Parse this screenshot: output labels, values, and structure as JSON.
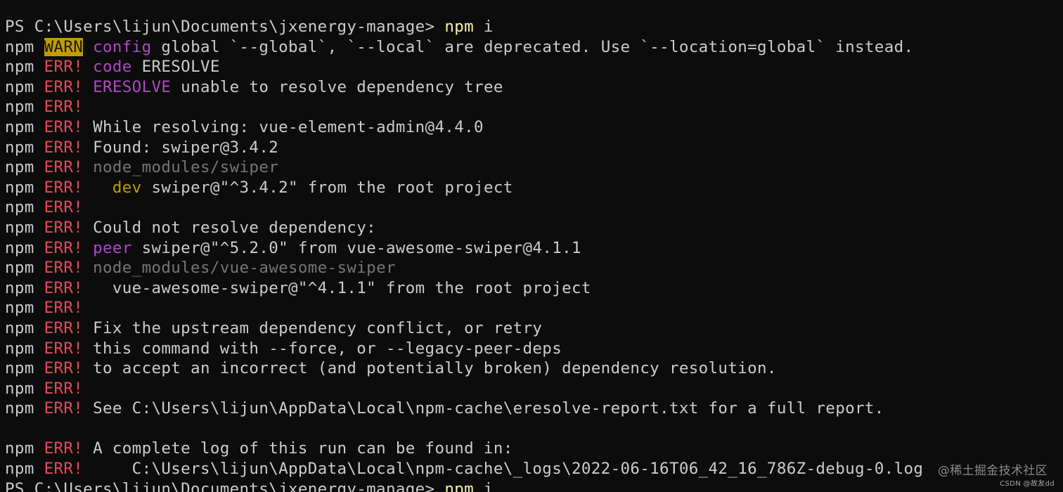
{
  "terminal": {
    "lines": [
      [
        {
          "text": "PS C:\\Users\\lijun\\Documents\\jxenergy-manage> ",
          "style": "default"
        },
        {
          "text": "npm",
          "style": "cmd"
        },
        {
          "text": " i",
          "style": "default"
        }
      ],
      [
        {
          "text": "npm ",
          "style": "default"
        },
        {
          "text": "WARN",
          "style": "warn"
        },
        {
          "text": " ",
          "style": "default"
        },
        {
          "text": "config",
          "style": "magenta"
        },
        {
          "text": " global `--global`, `--local` are deprecated. Use `--location=global` instead.",
          "style": "default"
        }
      ],
      [
        {
          "text": "npm ",
          "style": "default"
        },
        {
          "text": "ERR!",
          "style": "err"
        },
        {
          "text": " ",
          "style": "default"
        },
        {
          "text": "code",
          "style": "magenta"
        },
        {
          "text": " ERESOLVE",
          "style": "default"
        }
      ],
      [
        {
          "text": "npm ",
          "style": "default"
        },
        {
          "text": "ERR!",
          "style": "err"
        },
        {
          "text": " ",
          "style": "default"
        },
        {
          "text": "ERESOLVE",
          "style": "magenta"
        },
        {
          "text": " unable to resolve dependency tree",
          "style": "default"
        }
      ],
      [
        {
          "text": "npm ",
          "style": "default"
        },
        {
          "text": "ERR!",
          "style": "err"
        }
      ],
      [
        {
          "text": "npm ",
          "style": "default"
        },
        {
          "text": "ERR!",
          "style": "err"
        },
        {
          "text": " While resolving: vue-element-admin@4.4.0",
          "style": "default"
        }
      ],
      [
        {
          "text": "npm ",
          "style": "default"
        },
        {
          "text": "ERR!",
          "style": "err"
        },
        {
          "text": " Found: swiper@3.4.2",
          "style": "default"
        }
      ],
      [
        {
          "text": "npm ",
          "style": "default"
        },
        {
          "text": "ERR!",
          "style": "err"
        },
        {
          "text": " ",
          "style": "default"
        },
        {
          "text": "node_modules/swiper",
          "style": "gray"
        }
      ],
      [
        {
          "text": "npm ",
          "style": "default"
        },
        {
          "text": "ERR!",
          "style": "err"
        },
        {
          "text": "   ",
          "style": "default"
        },
        {
          "text": "dev",
          "style": "yellow"
        },
        {
          "text": " swiper@\"^3.4.2\" from the root project",
          "style": "default"
        }
      ],
      [
        {
          "text": "npm ",
          "style": "default"
        },
        {
          "text": "ERR!",
          "style": "err"
        }
      ],
      [
        {
          "text": "npm ",
          "style": "default"
        },
        {
          "text": "ERR!",
          "style": "err"
        },
        {
          "text": " Could not resolve dependency:",
          "style": "default"
        }
      ],
      [
        {
          "text": "npm ",
          "style": "default"
        },
        {
          "text": "ERR!",
          "style": "err"
        },
        {
          "text": " ",
          "style": "default"
        },
        {
          "text": "peer",
          "style": "magenta"
        },
        {
          "text": " swiper@\"^5.2.0\" from vue-awesome-swiper@4.1.1",
          "style": "default"
        }
      ],
      [
        {
          "text": "npm ",
          "style": "default"
        },
        {
          "text": "ERR!",
          "style": "err"
        },
        {
          "text": " ",
          "style": "default"
        },
        {
          "text": "node_modules/vue-awesome-swiper",
          "style": "gray"
        }
      ],
      [
        {
          "text": "npm ",
          "style": "default"
        },
        {
          "text": "ERR!",
          "style": "err"
        },
        {
          "text": "   vue-awesome-swiper@\"^4.1.1\" from the root project",
          "style": "default"
        }
      ],
      [
        {
          "text": "npm ",
          "style": "default"
        },
        {
          "text": "ERR!",
          "style": "err"
        }
      ],
      [
        {
          "text": "npm ",
          "style": "default"
        },
        {
          "text": "ERR!",
          "style": "err"
        },
        {
          "text": " Fix the upstream dependency conflict, or retry",
          "style": "default"
        }
      ],
      [
        {
          "text": "npm ",
          "style": "default"
        },
        {
          "text": "ERR!",
          "style": "err"
        },
        {
          "text": " this command with --force, or --legacy-peer-deps",
          "style": "default"
        }
      ],
      [
        {
          "text": "npm ",
          "style": "default"
        },
        {
          "text": "ERR!",
          "style": "err"
        },
        {
          "text": " to accept an incorrect (and potentially broken) dependency resolution.",
          "style": "default"
        }
      ],
      [
        {
          "text": "npm ",
          "style": "default"
        },
        {
          "text": "ERR!",
          "style": "err"
        }
      ],
      [
        {
          "text": "npm ",
          "style": "default"
        },
        {
          "text": "ERR!",
          "style": "err"
        },
        {
          "text": " See C:\\Users\\lijun\\AppData\\Local\\npm-cache\\eresolve-report.txt for a full report.",
          "style": "default"
        }
      ],
      [],
      [
        {
          "text": "npm ",
          "style": "default"
        },
        {
          "text": "ERR!",
          "style": "err"
        },
        {
          "text": " A complete log of this run can be found in:",
          "style": "default"
        }
      ],
      [
        {
          "text": "npm ",
          "style": "default"
        },
        {
          "text": "ERR!",
          "style": "err"
        },
        {
          "text": "     C:\\Users\\lijun\\AppData\\Local\\npm-cache\\_logs\\2022-06-16T06_42_16_786Z-debug-0.log",
          "style": "default"
        }
      ],
      [
        {
          "text": "PS C:\\Users\\lijun\\Documents\\jxenergy-manage> ",
          "style": "default"
        },
        {
          "text": "npm",
          "style": "cmd"
        },
        {
          "text": " i",
          "style": "default"
        }
      ]
    ]
  },
  "watermark": {
    "text": "@稀土掘金技术社区",
    "csdn": "CSDN @故友dd"
  },
  "colors": {
    "background": "#0c0c0c",
    "foreground": "#cccccc",
    "command": "#f9f1a5",
    "error": "#e74856",
    "warn_bg": "#c19c00",
    "magenta": "#b148c6",
    "gray": "#767676",
    "yellow": "#c19c00"
  }
}
